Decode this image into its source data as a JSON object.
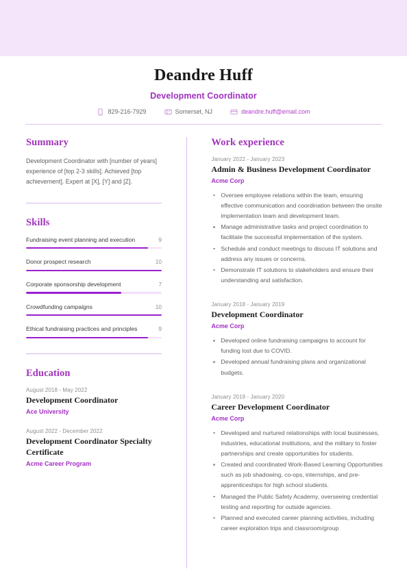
{
  "theme": {
    "banner_color": "#f5e5fb",
    "accent_color": "#a233bb",
    "bar_fill_color": "#9b1fce",
    "bar_track_color": "#f3dff8",
    "rule_color": "#ddb9ec"
  },
  "header": {
    "name": "Deandre Huff",
    "job_title": "Development Coordinator",
    "contacts": [
      {
        "icon": "phone-icon",
        "value": "829-216-7929"
      },
      {
        "icon": "address-icon",
        "value": "Somerset, NJ"
      },
      {
        "icon": "email-icon",
        "value": "deandre.huff@email.com"
      }
    ]
  },
  "summary": {
    "heading": "Summary",
    "text": "Development Coordinator with [number of years] experience of [top 2-3 skills]. Achieved [top achievement]. Expert at [X], [Y] and [Z]."
  },
  "skills": {
    "heading": "Skills",
    "max_score": 10,
    "items": [
      {
        "name": "Fundraising event planning and execution",
        "score": "9",
        "percent": 90
      },
      {
        "name": "Donor prospect research",
        "score": "10",
        "percent": 100
      },
      {
        "name": "Corporate sponsorship development",
        "score": "7",
        "percent": 70
      },
      {
        "name": "Crowdfunding campaigns",
        "score": "10",
        "percent": 100
      },
      {
        "name": "Ethical fundraising practices and principles",
        "score": "9",
        "percent": 90
      }
    ]
  },
  "education": {
    "heading": "Education",
    "items": [
      {
        "date": "August 2018 - May 2022",
        "title": "Development Coordinator",
        "org": "Ace University"
      },
      {
        "date": "August 2022 - December 2022",
        "title": "Development Coordinator Specialty Certificate",
        "org": "Acme Career Program"
      }
    ]
  },
  "work": {
    "heading": "Work experience",
    "items": [
      {
        "date": "January 2022 - January 2023",
        "title": "Admin & Business Development Coordinator",
        "org": "Acme Corp",
        "bullets": [
          "Oversee employee relations within the team, ensuring effective communication and coordination between the onsite implementation team and development team.",
          "Manage administrative tasks and project coordination to facilitate the successful implementation of the system.",
          "Schedule and conduct meetings to discuss IT solutions and address any issues or concerns.",
          "Demonstrate IT solutions to stakeholders and ensure their understanding and satisfaction."
        ]
      },
      {
        "date": "January 2018 - January 2019",
        "title": "Development Coordinator",
        "org": "Acme Corp",
        "bullets": [
          "Developed online fundraising campaigns to account for funding lost due to COVID.",
          "Developed annual fundraising plans and organizational budgets."
        ]
      },
      {
        "date": "January 2019 - January 2020",
        "title": "Career Development Coordinator",
        "org": "Acme Corp",
        "bullets": [
          "Developed and nurtured relationships with local businesses, industries, educational institutions, and the military to foster partnerships and create opportunities for students.",
          "Created and coordinated Work-Based Learning Opportunities such as job shadowing, co-ops, internships, and pre-apprenticeships for high school students.",
          "Managed the Public Safety Academy, overseeing credential testing and reporting for outside agencies.",
          "Planned and executed career planning activities, including career exploration trips and classroom/group"
        ]
      }
    ]
  }
}
